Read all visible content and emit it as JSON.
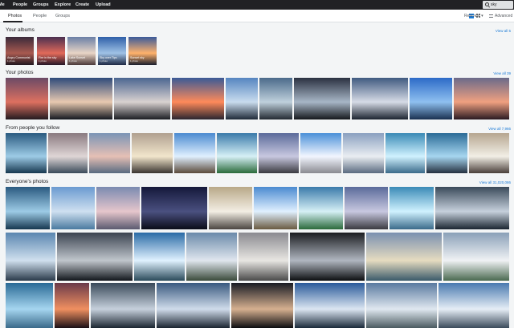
{
  "topnav": {
    "items": [
      "Me",
      "People",
      "Groups",
      "Explore",
      "Create",
      "Upload"
    ],
    "search_value": "sky"
  },
  "subnav": {
    "tabs": [
      "Photos",
      "People",
      "Groups"
    ],
    "active_tab": "Photos",
    "sort_label": "Relevant",
    "advanced_label": "Advanced"
  },
  "albums_section": {
    "title": "Your albums",
    "view_all": "View all 5",
    "albums": [
      {
        "name": "Angry Communist",
        "count": "1 photo",
        "colors": [
          "#3a2a3a",
          "#a85a50",
          "#231820"
        ]
      },
      {
        "name": "Fire in the sky",
        "count": "1 photo",
        "colors": [
          "#4a3050",
          "#e26a5a",
          "#281828"
        ]
      },
      {
        "name": "Lake Sunset",
        "count": "1 photo",
        "colors": [
          "#6a7fa6",
          "#e9d5c6",
          "#4c3a3a"
        ]
      },
      {
        "name": "Sky over Tips",
        "count": "1 photo",
        "colors": [
          "#2e5fa8",
          "#9fc2e6",
          "#1f2a45"
        ]
      },
      {
        "name": "Sunset sky",
        "count": "1 photo",
        "colors": [
          "#3a5a9a",
          "#ffb26b",
          "#1a1f2e"
        ]
      }
    ]
  },
  "your_photos": {
    "title": "Your photos",
    "view_all": "View all 39",
    "photos": [
      [
        "#6b4a66",
        "#dd7060",
        "#231a20"
      ],
      [
        "#2e4a7a",
        "#e8c9b0",
        "#141820"
      ],
      [
        "#4a6590",
        "#d9d2d0",
        "#1b1d22"
      ],
      [
        "#3a5a96",
        "#ff8a5a",
        "#2a2530"
      ],
      [
        "#5585c0",
        "#c9dcee",
        "#1f2a38"
      ],
      [
        "#4a6a8a",
        "#bfd0dc",
        "#232a32"
      ],
      [
        "#2a3040",
        "#a7b6c6",
        "#15181c"
      ],
      [
        "#3f5a80",
        "#d6dbe6",
        "#1c2430"
      ],
      [
        "#2c6ac7",
        "#8fc0f0",
        "#1a3050"
      ],
      [
        "#6a6a8a",
        "#f0a080",
        "#2a1a22"
      ]
    ]
  },
  "follow_photos": {
    "title": "From people you follow",
    "view_all": "View all 7,966",
    "photos": [
      [
        "#2a5a80",
        "#9dcbe6",
        "#16374f"
      ],
      [
        "#8a7a80",
        "#dfd6d6",
        "#3a4a5a"
      ],
      [
        "#7a94b5",
        "#e6c0b5",
        "#586a80"
      ],
      [
        "#b0a090",
        "#f2e6cc",
        "#3a3530"
      ],
      [
        "#4a8ad0",
        "#e0f0ff",
        "#5a4a3a"
      ],
      [
        "#3a7aaa",
        "#d6f0f6",
        "#2a6a3a"
      ],
      [
        "#5a6a9a",
        "#c8c8e0",
        "#3a3a40"
      ],
      [
        "#4a90d8",
        "#f2f6ff",
        "#8a8a90"
      ],
      [
        "#8aa0c0",
        "#eaeef2",
        "#5a6a80"
      ],
      [
        "#3a8ab6",
        "#d0f2ff",
        "#3a6a8a"
      ],
      [
        "#2a6a96",
        "#a6d6f0",
        "#253040"
      ],
      [
        "#b6a690",
        "#f2efe6",
        "#4a3f3a"
      ]
    ]
  },
  "everyone_photos": {
    "title": "Everyone's photos",
    "view_all": "View all 31,020,086",
    "rows": [
      [
        [
          "#2a5a80",
          "#9dcbe6",
          "#16374f"
        ],
        [
          "#6a9ad0",
          "#cfe0f0",
          "#4a7aa0"
        ],
        [
          "#7a8ab0",
          "#e6c6cc",
          "#5a5a70"
        ],
        [
          "#14183a",
          "#4a5080",
          "#0a0c18"
        ],
        [
          "#b8a888",
          "#f3eee4",
          "#4a4540"
        ],
        [
          "#4a8ad0",
          "#e0f0ff",
          "#6a5a40"
        ],
        [
          "#3a7aaa",
          "#d6f0f6",
          "#2a6a3a"
        ],
        [
          "#5a6a9a",
          "#c8c8e0",
          "#3a3a40"
        ],
        [
          "#3a8ab6",
          "#d0f2ff",
          "#3a6a8a"
        ],
        [
          "#3a4a5a",
          "#c6d0dc",
          "#1a2530"
        ]
      ],
      [
        [
          "#5a86b0",
          "#d0e0ee",
          "#2a3a4a"
        ],
        [
          "#3a4250",
          "#c0c6cc",
          "#12161c"
        ],
        [
          "#2a6aa6",
          "#e0f2ff",
          "#2a4a5a"
        ],
        [
          "#6a8aaa",
          "#e0e6ee",
          "#3a4a3a"
        ],
        [
          "#8a8a90",
          "#e8e6e2",
          "#4a4a4a"
        ],
        [
          "#1a1c20",
          "#b0b6c0",
          "#0c0e10"
        ],
        [
          "#7a90b0",
          "#e6dcc0",
          "#3a5a6a"
        ],
        [
          "#8aa0b8",
          "#f0f2f4",
          "#4a6a50"
        ]
      ],
      [
        [
          "#2a6a96",
          "#a6d6f0",
          "#3a6a8a"
        ],
        [
          "#6a3a4a",
          "#f09060",
          "#1a1016"
        ],
        [
          "#3a4a5a",
          "#c6d0dc",
          "#1a2530"
        ],
        [
          "#3a5a80",
          "#d0dceb",
          "#1a2430"
        ],
        [
          "#1a1c24",
          "#d6b090",
          "#0c0c10"
        ],
        [
          "#2a5a9a",
          "#dce6f2",
          "#1a2a3a"
        ],
        [
          "#5a7aa0",
          "#e0e8f0",
          "#4a5a60"
        ],
        [
          "#4a7ab0",
          "#e6eef6",
          "#3a4a5a"
        ]
      ]
    ]
  }
}
